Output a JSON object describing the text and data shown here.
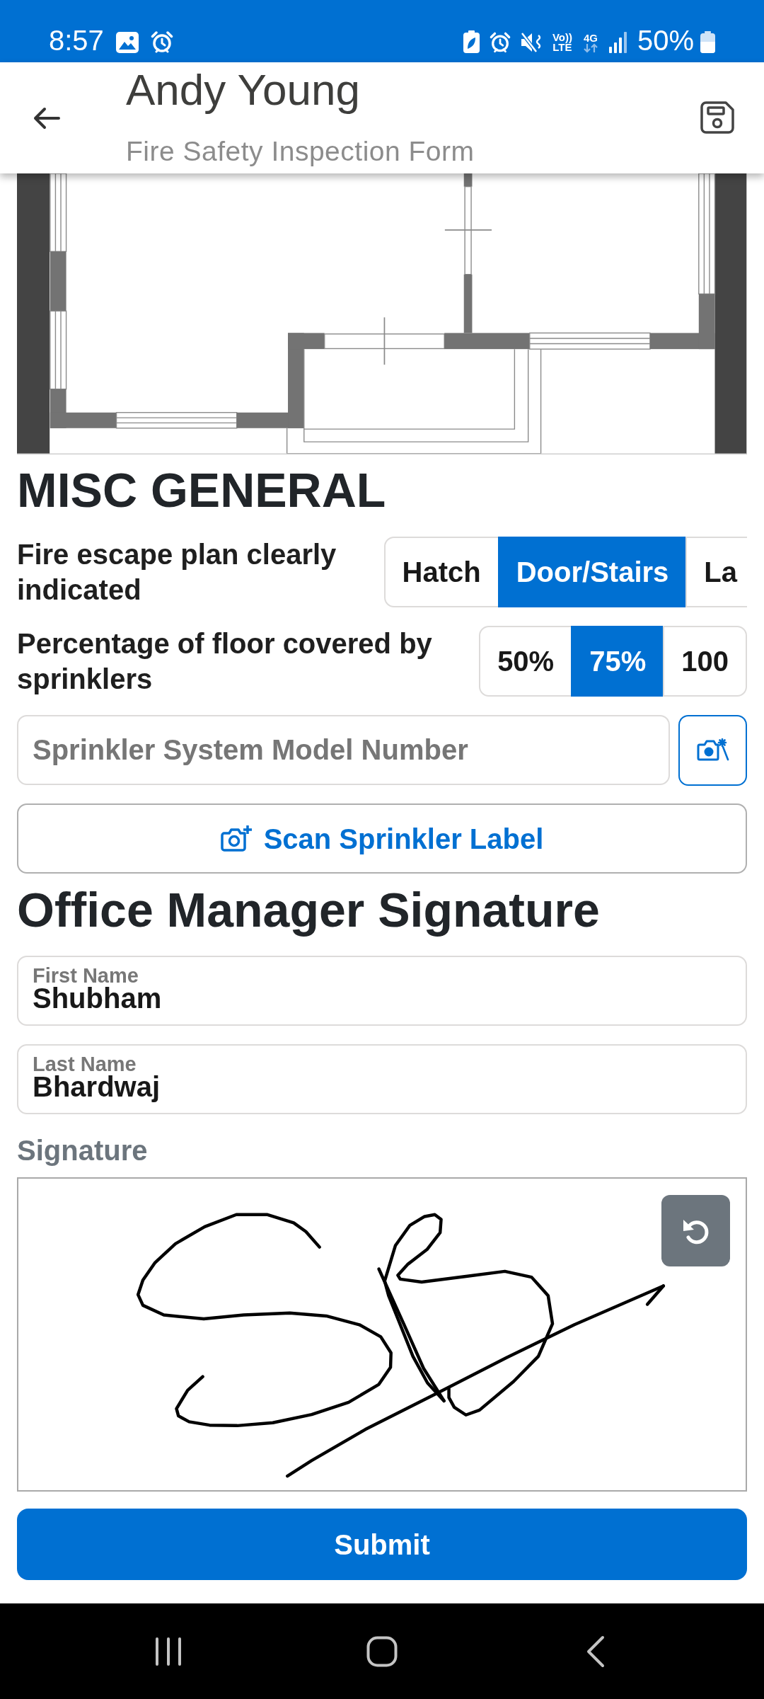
{
  "status_bar": {
    "time": "8:57",
    "volte": [
      "Vo))",
      "LTE"
    ],
    "network": "4G",
    "battery": "50%"
  },
  "header": {
    "title": "Andy Young",
    "subtitle": "Fire Safety Inspection Form"
  },
  "sections": [
    {
      "heading": "MISC GENERAL",
      "fields": [
        {
          "kind": "choice",
          "label": "Fire escape plan clearly indicated",
          "clipped": true,
          "options": [
            {
              "label": "Hatch",
              "selected": false
            },
            {
              "label": "Door/Stairs",
              "selected": true
            },
            {
              "label": "La",
              "selected": false
            }
          ]
        },
        {
          "kind": "choice",
          "label": "Percentage of floor covered by sprinklers",
          "clipped": false,
          "options": [
            {
              "label": "50%",
              "selected": false
            },
            {
              "label": "75%",
              "selected": true
            },
            {
              "label": "100",
              "selected": false
            }
          ]
        },
        {
          "kind": "scan_input",
          "placeholder": "Sprinkler System Model Number"
        },
        {
          "kind": "button",
          "label": "Scan Sprinkler Label"
        }
      ]
    },
    {
      "heading": "Office Manager Signature",
      "fields": [
        {
          "kind": "floating_text",
          "label": "First Name",
          "value": "Shubham"
        },
        {
          "kind": "floating_text",
          "label": "Last Name",
          "value": "Bhardwaj"
        },
        {
          "kind": "signature",
          "label": "Signature"
        }
      ]
    }
  ],
  "submit": {
    "label": "Submit"
  }
}
